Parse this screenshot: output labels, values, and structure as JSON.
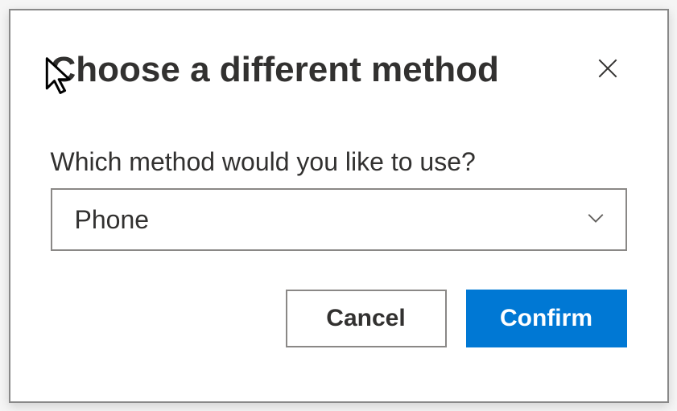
{
  "dialog": {
    "title": "Choose a different method",
    "prompt": "Which method would you like to use?",
    "selected_method": "Phone"
  },
  "buttons": {
    "cancel": "Cancel",
    "confirm": "Confirm"
  },
  "colors": {
    "primary": "#0078d4",
    "text": "#323130",
    "border": "#8a8886"
  }
}
